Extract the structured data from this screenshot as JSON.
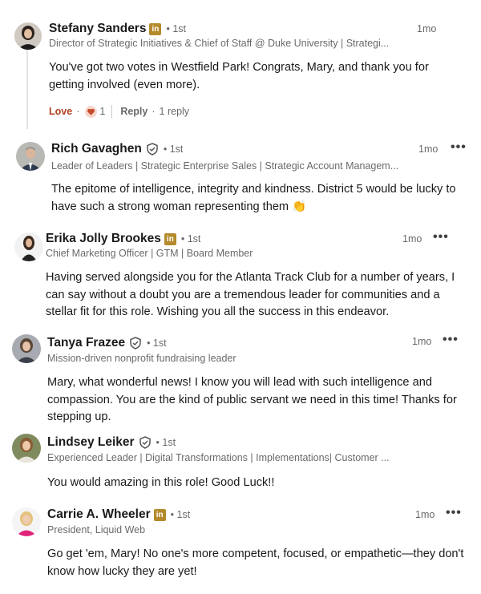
{
  "comments": [
    {
      "name": "Stefany Sanders",
      "badge": "linkedin-premium-icon",
      "degree": "• 1st",
      "headline": "Director of Strategic Initiatives & Chief of Staff @ Duke University | Strategi...",
      "time": "1mo",
      "text": "You've got two votes in Westfield Park! Congrats, Mary, and thank you for getting involved (even more).",
      "reaction_label": "Love",
      "reaction_count": "1",
      "reply_label": "Reply",
      "reply_count": "1 reply"
    },
    {
      "name": "Rich Gavaghen",
      "badge": "verified-icon",
      "degree": "• 1st",
      "headline": "Leader of Leaders | Strategic Enterprise Sales | Strategic Account Managem...",
      "time": "1mo",
      "more": "•••",
      "text": "The epitome of intelligence, integrity and kindness. District 5 would be lucky to have such a strong woman representing them",
      "emoji": "👏"
    },
    {
      "name": "Erika Jolly Brookes",
      "badge": "linkedin-premium-icon",
      "degree": "• 1st",
      "headline": "Chief Marketing Officer | GTM | Board Member",
      "time": "1mo",
      "more": "•••",
      "text": "Having served alongside you for the Atlanta Track Club for a number of years, I can say without a doubt you are a tremendous leader for communities and a stellar fit for this role. Wishing you all the success in this endeavor."
    },
    {
      "name": "Tanya Frazee",
      "badge": "verified-icon",
      "degree": "• 1st",
      "headline": "Mission-driven nonprofit fundraising leader",
      "time": "1mo",
      "more": "•••",
      "text": "Mary, what wonderful news! I know you will lead with such intelligence and compassion. You are the kind of public servant we need in this time! Thanks for stepping up."
    },
    {
      "name": "Lindsey Leiker",
      "badge": "verified-icon",
      "degree": "• 1st",
      "headline": "Experienced Leader | Digital Transformations | Implementations| Customer ...",
      "text": "You would amazing in this role! Good Luck!!"
    },
    {
      "name": "Carrie A. Wheeler",
      "badge": "linkedin-premium-icon",
      "degree": "• 1st",
      "headline": "President, Liquid Web",
      "time": "1mo",
      "more": "•••",
      "text": "Go get 'em, Mary! No one's more competent, focused, or empathetic—they don't know how lucky they are yet!"
    }
  ],
  "colors": {
    "premium_gold": "#b48a2c",
    "love_red": "#b24020",
    "muted_text": "#666666"
  }
}
